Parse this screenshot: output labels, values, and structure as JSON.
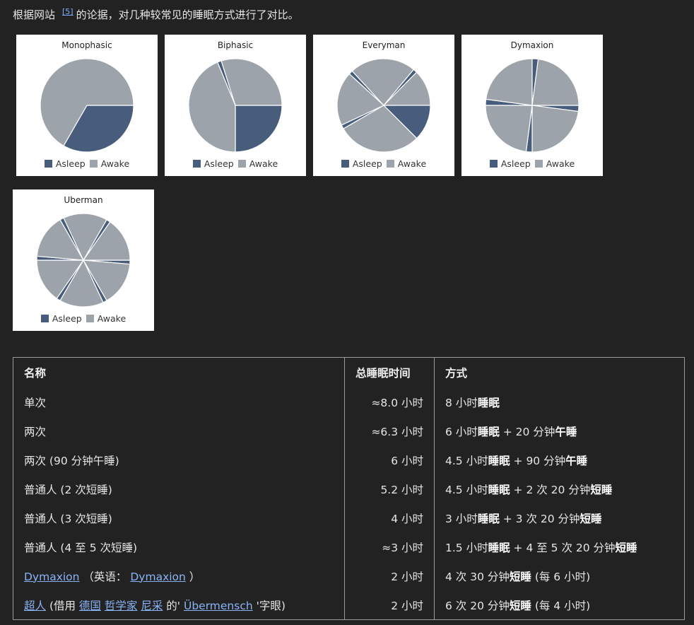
{
  "intro": {
    "before": "根据网站",
    "ref": "[5]",
    "after": "的论据，对几种较常见的睡眠方式进行了对比。"
  },
  "colors": {
    "asleep": "#485c7c",
    "awake": "#9da3ab",
    "panel_bg": "#ffffff",
    "link": "#8ab4f8"
  },
  "legend": {
    "asleep": "Asleep",
    "awake": "Awake"
  },
  "chart_data": [
    {
      "type": "pie",
      "title": "Monophasic",
      "hours_per_day": 24,
      "segments": [
        {
          "label": "Asleep",
          "hours": 8
        },
        {
          "label": "Awake",
          "hours": 16
        }
      ]
    },
    {
      "type": "pie",
      "title": "Biphasic",
      "hours_per_day": 24,
      "segments": [
        {
          "label": "Asleep",
          "hours": 6
        },
        {
          "label": "Awake",
          "hours": 10.5
        },
        {
          "label": "Asleep",
          "hours": 0.33
        },
        {
          "label": "Awake",
          "hours": 7.17
        }
      ]
    },
    {
      "type": "pie",
      "title": "Everyman",
      "hours_per_day": 24,
      "segments": [
        {
          "label": "Asleep",
          "hours": 3
        },
        {
          "label": "Awake",
          "hours": 7
        },
        {
          "label": "Asleep",
          "hours": 0.33
        },
        {
          "label": "Awake",
          "hours": 4.5
        },
        {
          "label": "Asleep",
          "hours": 0.33
        },
        {
          "label": "Awake",
          "hours": 5.5
        },
        {
          "label": "Asleep",
          "hours": 0.33
        },
        {
          "label": "Awake",
          "hours": 3
        }
      ]
    },
    {
      "type": "pie",
      "title": "Dymaxion",
      "hours_per_day": 24,
      "segments": [
        {
          "label": "Asleep",
          "hours": 0.5
        },
        {
          "label": "Awake",
          "hours": 5.5
        },
        {
          "label": "Asleep",
          "hours": 0.5
        },
        {
          "label": "Awake",
          "hours": 5.5
        },
        {
          "label": "Asleep",
          "hours": 0.5
        },
        {
          "label": "Awake",
          "hours": 5.5
        },
        {
          "label": "Asleep",
          "hours": 0.5
        },
        {
          "label": "Awake",
          "hours": 5.5
        }
      ]
    },
    {
      "type": "pie",
      "title": "Uberman",
      "hours_per_day": 24,
      "segments": [
        {
          "label": "Asleep",
          "hours": 0.33
        },
        {
          "label": "Awake",
          "hours": 3.67
        },
        {
          "label": "Asleep",
          "hours": 0.33
        },
        {
          "label": "Awake",
          "hours": 3.67
        },
        {
          "label": "Asleep",
          "hours": 0.33
        },
        {
          "label": "Awake",
          "hours": 3.67
        },
        {
          "label": "Asleep",
          "hours": 0.33
        },
        {
          "label": "Awake",
          "hours": 3.67
        },
        {
          "label": "Asleep",
          "hours": 0.33
        },
        {
          "label": "Awake",
          "hours": 3.67
        },
        {
          "label": "Asleep",
          "hours": 0.33
        },
        {
          "label": "Awake",
          "hours": 3.67
        }
      ]
    }
  ],
  "table": {
    "headers": [
      "名称",
      "总睡眠时间",
      "方式"
    ],
    "rows": [
      {
        "name": [
          {
            "text": "单次"
          }
        ],
        "total": "≈8.0 小时",
        "method": [
          {
            "text": "8 小时"
          },
          {
            "text": "睡眠",
            "bold": true
          }
        ]
      },
      {
        "name": [
          {
            "text": "两次"
          }
        ],
        "total": "≈6.3 小时",
        "method": [
          {
            "text": "6 小时"
          },
          {
            "text": "睡眠",
            "bold": true
          },
          {
            "text": " + 20 分钟"
          },
          {
            "text": "午睡",
            "bold": true
          }
        ]
      },
      {
        "name": [
          {
            "text": "两次 (90 分钟午睡)"
          }
        ],
        "total": "6 小时",
        "method": [
          {
            "text": "4.5 小时"
          },
          {
            "text": "睡眠",
            "bold": true
          },
          {
            "text": " + 90 分钟"
          },
          {
            "text": "午睡",
            "bold": true
          }
        ]
      },
      {
        "name": [
          {
            "text": "普通人 (2 次短睡)"
          }
        ],
        "total": "5.2 小时",
        "method": [
          {
            "text": "4.5 小时"
          },
          {
            "text": "睡眠",
            "bold": true
          },
          {
            "text": " + 2 次 20 分钟"
          },
          {
            "text": "短睡",
            "bold": true
          }
        ]
      },
      {
        "name": [
          {
            "text": "普通人 (3 次短睡)"
          }
        ],
        "total": "4 小时",
        "method": [
          {
            "text": "3 小时"
          },
          {
            "text": "睡眠",
            "bold": true
          },
          {
            "text": " + 3 次 20 分钟"
          },
          {
            "text": "短睡",
            "bold": true
          }
        ]
      },
      {
        "name": [
          {
            "text": "普通人 (4 至 5 次短睡)"
          }
        ],
        "total": "≈3 小时",
        "method": [
          {
            "text": "1.5 小时"
          },
          {
            "text": "睡眠",
            "bold": true
          },
          {
            "text": " + 4 至 5 次 20 分钟"
          },
          {
            "text": "短睡",
            "bold": true
          }
        ]
      },
      {
        "name": [
          {
            "text": " "
          },
          {
            "text": "Dymaxion",
            "link": true
          },
          {
            "text": " （英语： "
          },
          {
            "text": "Dymaxion",
            "link": true
          },
          {
            "text": " ）"
          }
        ],
        "total": "2 小时",
        "method": [
          {
            "text": "4 次 30 分钟"
          },
          {
            "text": "短睡",
            "bold": true
          },
          {
            "text": " (每 6 小时)"
          }
        ]
      },
      {
        "name": [
          {
            "text": " "
          },
          {
            "text": "超人",
            "link": true
          },
          {
            "text": " (借用 "
          },
          {
            "text": "德国",
            "link": true
          },
          {
            "text": " "
          },
          {
            "text": "哲学家",
            "link": true
          },
          {
            "text": " "
          },
          {
            "text": "尼采",
            "link": true
          },
          {
            "text": " 的' "
          },
          {
            "text": "Übermensch",
            "link": true
          },
          {
            "text": " '字眼)"
          }
        ],
        "total": "2 小时",
        "method": [
          {
            "text": "6 次 20 分钟"
          },
          {
            "text": "短睡",
            "bold": true
          },
          {
            "text": " (每 4 小时)"
          }
        ]
      }
    ]
  }
}
